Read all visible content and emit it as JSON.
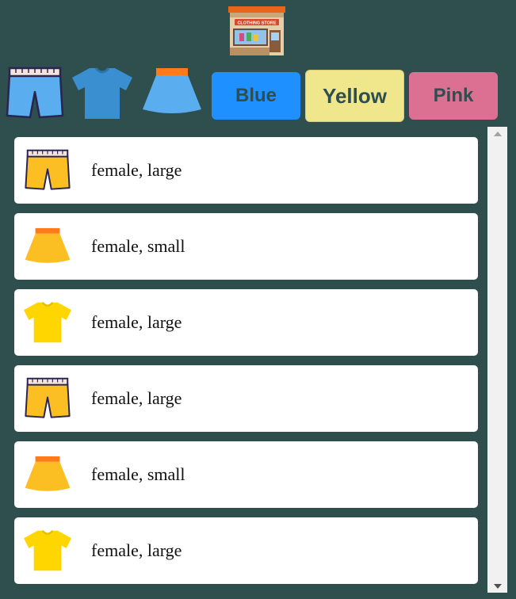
{
  "header": {
    "logo_icon": "clothing-store-icon",
    "logo_sign_text": "CLOTHING STORE"
  },
  "filters": {
    "types": [
      {
        "name": "shorts",
        "icon": "shorts-icon",
        "color": "#5aaef0"
      },
      {
        "name": "tshirt",
        "icon": "tshirt-icon",
        "color": "#3a8fd0"
      },
      {
        "name": "skirt",
        "icon": "skirt-icon",
        "color": "#5aaef0"
      }
    ],
    "colors": [
      {
        "label": "Blue",
        "bg": "#1e90ff"
      },
      {
        "label": "Yellow",
        "bg": "#f0e68c"
      },
      {
        "label": "Pink",
        "bg": "#db7093"
      }
    ]
  },
  "items": [
    {
      "icon": "shorts-icon",
      "color": "#fbbf24",
      "text": "female, large"
    },
    {
      "icon": "skirt-icon",
      "color": "#fbbf24",
      "text": "female, small"
    },
    {
      "icon": "tshirt-icon",
      "color": "#fbbf24",
      "text": "female, large"
    },
    {
      "icon": "shorts-icon",
      "color": "#fbbf24",
      "text": "female, large"
    },
    {
      "icon": "skirt-icon",
      "color": "#fbbf24",
      "text": "female, small"
    },
    {
      "icon": "tshirt-icon",
      "color": "#fbbf24",
      "text": "female, large"
    }
  ],
  "colors": {
    "background": "#2f4f4f",
    "card": "#ffffff"
  }
}
